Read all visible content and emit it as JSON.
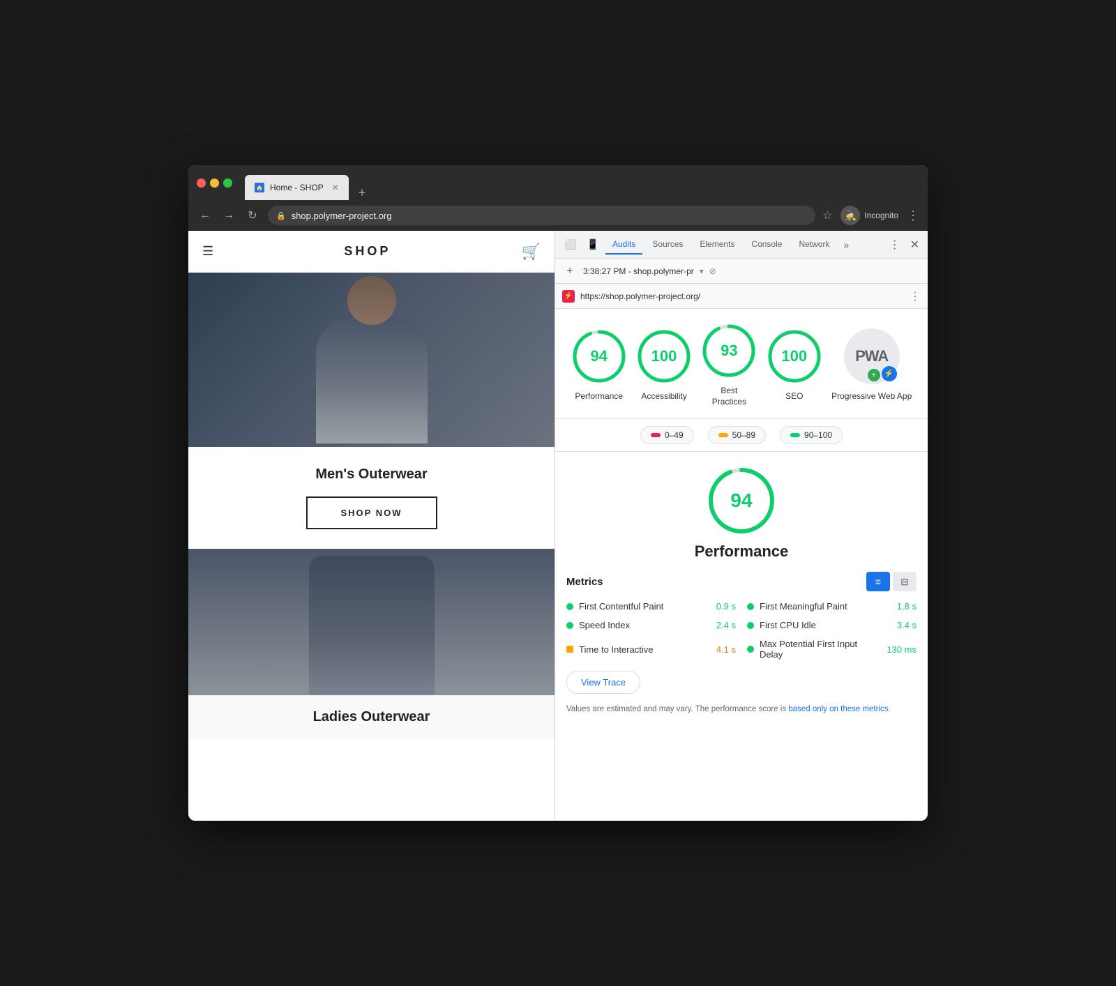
{
  "window": {
    "title": "Home - SHOP",
    "url": "shop.polymer-project.org",
    "full_url": "https://shop.polymer-project.org/",
    "timestamp": "3:38:27 PM - shop.polymer-pr",
    "incognito_label": "Incognito"
  },
  "devtools": {
    "tabs": [
      "Audits",
      "Sources",
      "Elements",
      "Console",
      "Network"
    ],
    "active_tab": "Audits"
  },
  "webpage": {
    "logo": "SHOP",
    "hero_section": "Men's Outerwear",
    "shop_now": "SHOP NOW",
    "ladies_section": "Ladies Outerwear"
  },
  "audit": {
    "scores": [
      {
        "label": "Performance",
        "value": "94",
        "pct": 94
      },
      {
        "label": "Accessibility",
        "value": "100",
        "pct": 100
      },
      {
        "label": "Best Practices",
        "value": "93",
        "pct": 93
      },
      {
        "label": "SEO",
        "value": "100",
        "pct": 100
      }
    ],
    "pwa_label": "Progressive Web App",
    "pwa_badge": "PWA",
    "legend": [
      {
        "range": "0–49",
        "color": "red"
      },
      {
        "range": "50–89",
        "color": "orange"
      },
      {
        "range": "90–100",
        "color": "green"
      }
    ],
    "performance": {
      "score": 94,
      "title": "Performance",
      "metrics_label": "Metrics",
      "metrics": [
        {
          "name": "First Contentful Paint",
          "value": "0.9 s",
          "color": "green"
        },
        {
          "name": "Speed Index",
          "value": "2.4 s",
          "color": "green"
        },
        {
          "name": "Time to Interactive",
          "value": "4.1 s",
          "color": "orange"
        },
        {
          "name": "First Meaningful Paint",
          "value": "1.8 s",
          "color": "green"
        },
        {
          "name": "First CPU Idle",
          "value": "3.4 s",
          "color": "green"
        },
        {
          "name": "Max Potential First Input Delay",
          "value": "130 ms",
          "color": "green"
        }
      ],
      "view_trace": "View Trace",
      "disclaimer_text": "Values are estimated and may vary. The performance score is ",
      "disclaimer_link": "based only on these metrics",
      "disclaimer_end": "."
    }
  }
}
